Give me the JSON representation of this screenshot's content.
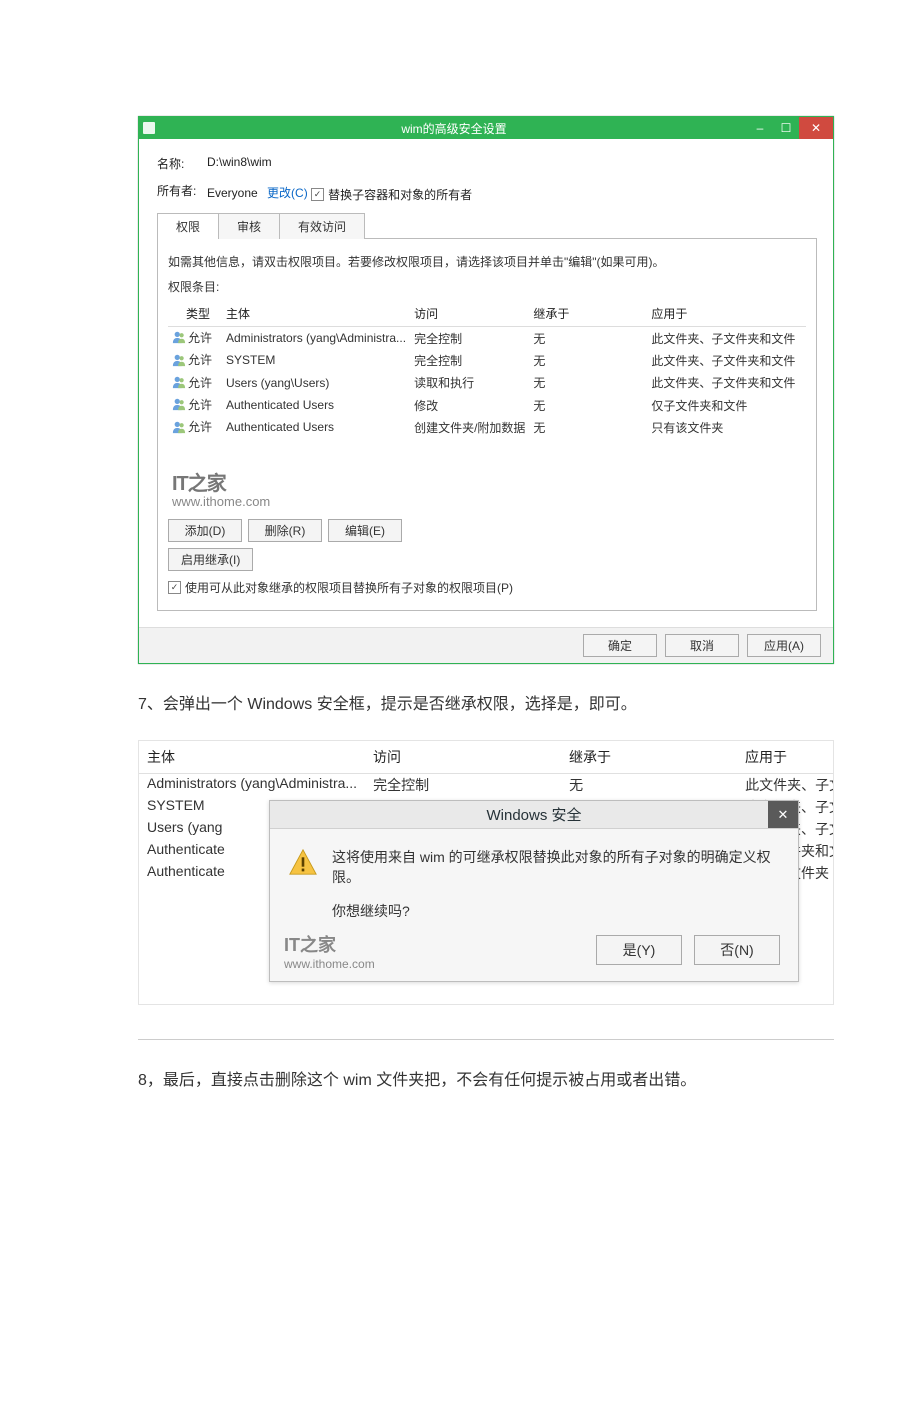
{
  "window1": {
    "title": "wim的高级安全设置",
    "fields": {
      "name_label": "名称:",
      "name_value": "D:\\win8\\wim",
      "owner_label": "所有者:",
      "owner_value": "Everyone",
      "owner_change": "更改(C)",
      "replace_owner_cb": "替换子容器和对象的所有者"
    },
    "tabs": {
      "perm": "权限",
      "audit": "审核",
      "effective": "有效访问"
    },
    "hint": "如需其他信息，请双击权限项目。若要修改权限项目，请选择该项目并单击\"编辑\"(如果可用)。",
    "entries_label": "权限条目:",
    "columns": {
      "type": "类型",
      "subject": "主体",
      "access": "访问",
      "inherit": "继承于",
      "apply": "应用于"
    },
    "rows": [
      {
        "type": "允许",
        "subject": "Administrators (yang\\Administra...",
        "access": "完全控制",
        "inherit": "无",
        "apply": "此文件夹、子文件夹和文件"
      },
      {
        "type": "允许",
        "subject": "SYSTEM",
        "access": "完全控制",
        "inherit": "无",
        "apply": "此文件夹、子文件夹和文件"
      },
      {
        "type": "允许",
        "subject": "Users (yang\\Users)",
        "access": "读取和执行",
        "inherit": "无",
        "apply": "此文件夹、子文件夹和文件"
      },
      {
        "type": "允许",
        "subject": "Authenticated Users",
        "access": "修改",
        "inherit": "无",
        "apply": "仅子文件夹和文件"
      },
      {
        "type": "允许",
        "subject": "Authenticated Users",
        "access": "创建文件夹/附加数据",
        "inherit": "无",
        "apply": "只有该文件夹"
      }
    ],
    "watermark_logo": "IT之家",
    "watermark_url": "www.ithome.com",
    "buttons": {
      "add": "添加(D)",
      "remove": "删除(R)",
      "edit": "编辑(E)",
      "enable_inherit": "启用继承(I)",
      "replace_children_cb": "使用可从此对象继承的权限项目替换所有子对象的权限项目(P)",
      "ok": "确定",
      "cancel": "取消",
      "apply": "应用(A)"
    }
  },
  "body_text_7": "7、会弹出一个 Windows 安全框，提示是否继承权限，选择是，即可。",
  "shot2": {
    "columns": {
      "subject": "主体",
      "access": "访问",
      "inherit": "继承于",
      "apply": "应用于"
    },
    "rows": [
      {
        "subject": "Administrators (yang\\Administra...",
        "access": "完全控制",
        "inherit": "无",
        "apply": "此文件夹、子文件夹和"
      },
      {
        "subject": "SYSTEM",
        "access": "",
        "inherit": "",
        "apply": "比文件夹、子文件夹和"
      },
      {
        "subject": "Users (yang",
        "access": "",
        "inherit": "",
        "apply": "比文件夹、子文件夹和"
      },
      {
        "subject": "Authenticate",
        "access": "",
        "inherit": "",
        "apply": "又子文件夹和文件"
      },
      {
        "subject": "Authenticate",
        "access": "",
        "inherit": "",
        "apply": "只有该文件夹"
      }
    ],
    "popup": {
      "title": "Windows 安全",
      "msg1": "这将使用来自 wim 的可继承权限替换此对象的所有子对象的明确定义权限。",
      "msg2": "你想继续吗?",
      "yes": "是(Y)",
      "no": "否(N)"
    },
    "watermark_logo": "IT之家",
    "watermark_url": "www.ithome.com"
  },
  "body_text_8": "8，最后，直接点击删除这个 wim 文件夹把，不会有任何提示被占用或者出错。"
}
